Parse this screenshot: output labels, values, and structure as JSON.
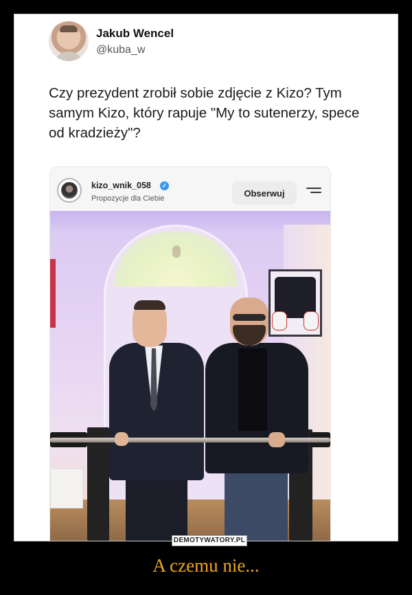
{
  "tweet": {
    "author_name": "Jakub Wencel",
    "handle": "@kuba_w",
    "text": "Czy prezydent zrobił sobie zdjęcie z Kizo? Tym samym Kizo, który rapuje \"My to sutenerzy, spece od kradzieży\"?"
  },
  "instagram_post": {
    "username": "kizo_wnik_058",
    "verified": true,
    "subtitle": "Propozycje dla Ciebie",
    "follow_label": "Obserwuj",
    "menu_icon": "menu-icon"
  },
  "watermark": "DEMOTYWATORY.PL",
  "caption": "A czemu nie...",
  "colors": {
    "background": "#000000",
    "caption": "#f0a81e",
    "verified": "#3897f0"
  }
}
